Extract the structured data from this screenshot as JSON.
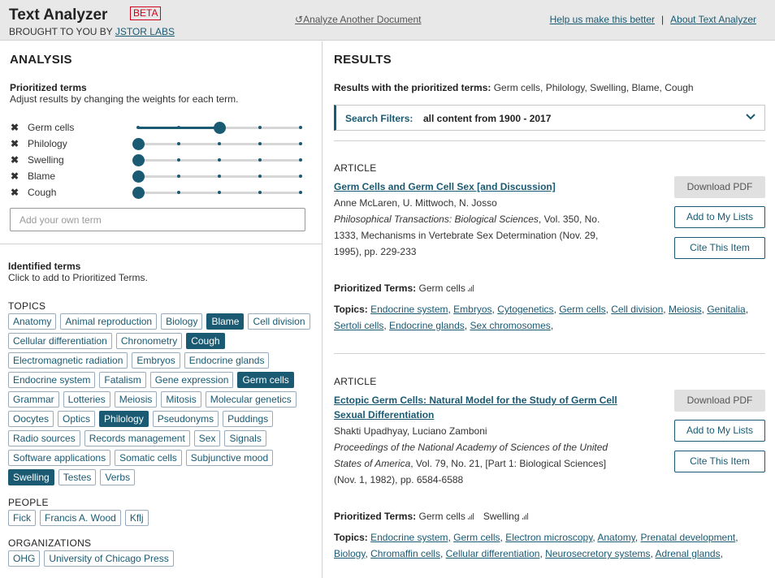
{
  "header": {
    "brand": "Text Analyzer",
    "beta": "BETA",
    "brought_prefix": "BROUGHT TO YOU BY",
    "brought_link": "JSTOR LABS",
    "analyze_another": "Analyze Another Document",
    "help_link": "Help us make this better",
    "separator": "|",
    "about_link": "About Text Analyzer"
  },
  "analysis": {
    "title": "ANALYSIS",
    "prioritized_title": "Prioritized terms",
    "prioritized_sub": "Adjust results by changing the weights for each term.",
    "terms": [
      {
        "label": "Germ cells",
        "weight": 2
      },
      {
        "label": "Philology",
        "weight": 0
      },
      {
        "label": "Swelling",
        "weight": 0
      },
      {
        "label": "Blame",
        "weight": 0
      },
      {
        "label": "Cough",
        "weight": 0
      }
    ],
    "slider_steps": 5,
    "add_placeholder": "Add your own term",
    "identified_title": "Identified terms",
    "identified_sub": "Click to add to Prioritized Terms.",
    "topics_label": "TOPICS",
    "topics": [
      {
        "label": "Anatomy",
        "selected": false
      },
      {
        "label": "Animal reproduction",
        "selected": false
      },
      {
        "label": "Biology",
        "selected": false
      },
      {
        "label": "Blame",
        "selected": true
      },
      {
        "label": "Cell division",
        "selected": false
      },
      {
        "label": "Cellular differentiation",
        "selected": false
      },
      {
        "label": "Chronometry",
        "selected": false
      },
      {
        "label": "Cough",
        "selected": true
      },
      {
        "label": "Electromagnetic radiation",
        "selected": false
      },
      {
        "label": "Embryos",
        "selected": false
      },
      {
        "label": "Endocrine glands",
        "selected": false
      },
      {
        "label": "Endocrine system",
        "selected": false
      },
      {
        "label": "Fatalism",
        "selected": false
      },
      {
        "label": "Gene expression",
        "selected": false
      },
      {
        "label": "Germ cells",
        "selected": true
      },
      {
        "label": "Grammar",
        "selected": false
      },
      {
        "label": "Lotteries",
        "selected": false
      },
      {
        "label": "Meiosis",
        "selected": false
      },
      {
        "label": "Mitosis",
        "selected": false
      },
      {
        "label": "Molecular genetics",
        "selected": false
      },
      {
        "label": "Oocytes",
        "selected": false
      },
      {
        "label": "Optics",
        "selected": false
      },
      {
        "label": "Philology",
        "selected": true
      },
      {
        "label": "Pseudonyms",
        "selected": false
      },
      {
        "label": "Puddings",
        "selected": false
      },
      {
        "label": "Radio sources",
        "selected": false
      },
      {
        "label": "Records management",
        "selected": false
      },
      {
        "label": "Sex",
        "selected": false
      },
      {
        "label": "Signals",
        "selected": false
      },
      {
        "label": "Software applications",
        "selected": false
      },
      {
        "label": "Somatic cells",
        "selected": false
      },
      {
        "label": "Subjunctive mood",
        "selected": false
      },
      {
        "label": "Swelling",
        "selected": true
      },
      {
        "label": "Testes",
        "selected": false
      },
      {
        "label": "Verbs",
        "selected": false
      }
    ],
    "people_label": "PEOPLE",
    "people": [
      "Fick",
      "Francis A. Wood",
      "Kflj"
    ],
    "orgs_label": "ORGANIZATIONS",
    "orgs": [
      "OHG",
      "University of Chicago Press"
    ]
  },
  "results": {
    "title": "RESULTS",
    "with_label": "Results with the prioritized terms:",
    "with_terms": "Germ cells, Philology, Swelling, Blame, Cough",
    "filter_label": "Search Filters:",
    "filter_value": "all content from 1900 - 2017",
    "articles": [
      {
        "type": "ARTICLE",
        "title": "Germ Cells and Germ Cell Sex [and Discussion]",
        "authors": "Anne McLaren, U. Mittwoch, N. Josso",
        "journal": "Philosophical Transactions: Biological Sciences",
        "cite_rest": ", Vol. 350, No. 1333, Mechanisms in Vertebrate Sex Determination (Nov. 29, 1995), pp. 229-233",
        "pdf_label": "Download PDF",
        "lists_label": "Add to My Lists",
        "cite_label": "Cite This Item",
        "pt_label": "Prioritized Terms:",
        "pt_terms": [
          "Germ cells"
        ],
        "topics_label": "Topics:",
        "topics": [
          "Endocrine system",
          "Embryos",
          "Cytogenetics",
          "Germ cells",
          "Cell division",
          "Meiosis",
          "Genitalia",
          "Sertoli cells",
          "Endocrine glands",
          "Sex chromosomes"
        ]
      },
      {
        "type": "ARTICLE",
        "title": "Ectopic Germ Cells: Natural Model for the Study of Germ Cell Sexual Differentiation",
        "authors": "Shakti Upadhyay, Luciano Zamboni",
        "journal": "Proceedings of the National Academy of Sciences of the United States of America",
        "cite_rest": ", Vol. 79, No. 21, [Part 1: Biological Sciences] (Nov. 1, 1982), pp. 6584-6588",
        "pdf_label": "Download PDF",
        "lists_label": "Add to My Lists",
        "cite_label": "Cite This Item",
        "pt_label": "Prioritized Terms:",
        "pt_terms": [
          "Germ cells",
          "Swelling"
        ],
        "topics_label": "Topics:",
        "topics": [
          "Endocrine system",
          "Germ cells",
          "Electron microscopy",
          "Anatomy",
          "Prenatal development",
          "Biology",
          "Chromaffin cells",
          "Cellular differentiation",
          "Neurosecretory systems",
          "Adrenal glands"
        ]
      }
    ]
  }
}
